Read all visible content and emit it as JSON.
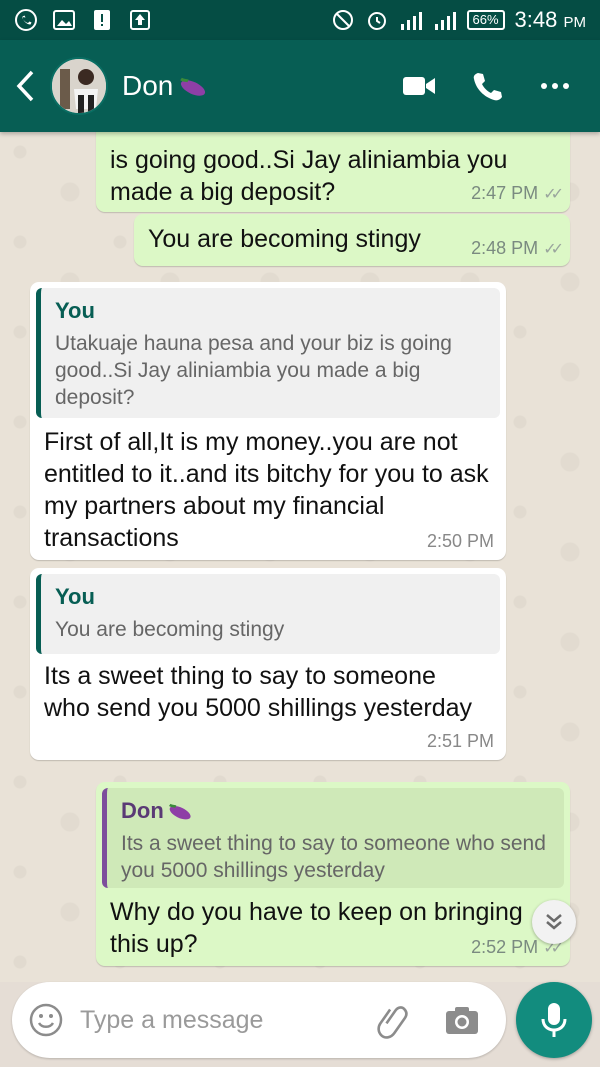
{
  "status_bar": {
    "battery": "66%",
    "time": "3:48",
    "ampm": "PM"
  },
  "header": {
    "contact_name": "Don",
    "contact_emoji": "eggplant-icon"
  },
  "messages": [
    {
      "id": "m1",
      "direction": "out",
      "text": "is going good..Si Jay aliniambia you made a big deposit?",
      "time": "2:47 PM",
      "status": "read"
    },
    {
      "id": "m2",
      "direction": "out",
      "text": "You are becoming stingy",
      "time": "2:48 PM",
      "status": "read"
    },
    {
      "id": "m3",
      "direction": "in",
      "quote_name": "You",
      "quote_text": "Utakuaje hauna pesa and your biz is going good..Si Jay aliniambia you made a big deposit?",
      "text": "First of all,It is my money..you are not entitled to it..and its bitchy for you to ask my partners about my financial transactions",
      "time": "2:50 PM"
    },
    {
      "id": "m4",
      "direction": "in",
      "quote_name": "You",
      "quote_text": "You are becoming stingy",
      "text": "Its a sweet thing to say to someone who send you 5000 shillings yesterday",
      "time": "2:51 PM"
    },
    {
      "id": "m5",
      "direction": "out",
      "quote_name": "Don",
      "quote_text": "Its a sweet thing to say to someone who send you 5000 shillings yesterday",
      "text": "Why do you have to keep on bringing this up?",
      "time": "2:52 PM",
      "status": "read"
    }
  ],
  "composer": {
    "placeholder": "Type a message"
  },
  "colors": {
    "header": "#075e54",
    "status_bar": "#054d44",
    "outgoing_bubble": "#dcf8c6",
    "incoming_bubble": "#ffffff",
    "accent": "#128c7e"
  }
}
